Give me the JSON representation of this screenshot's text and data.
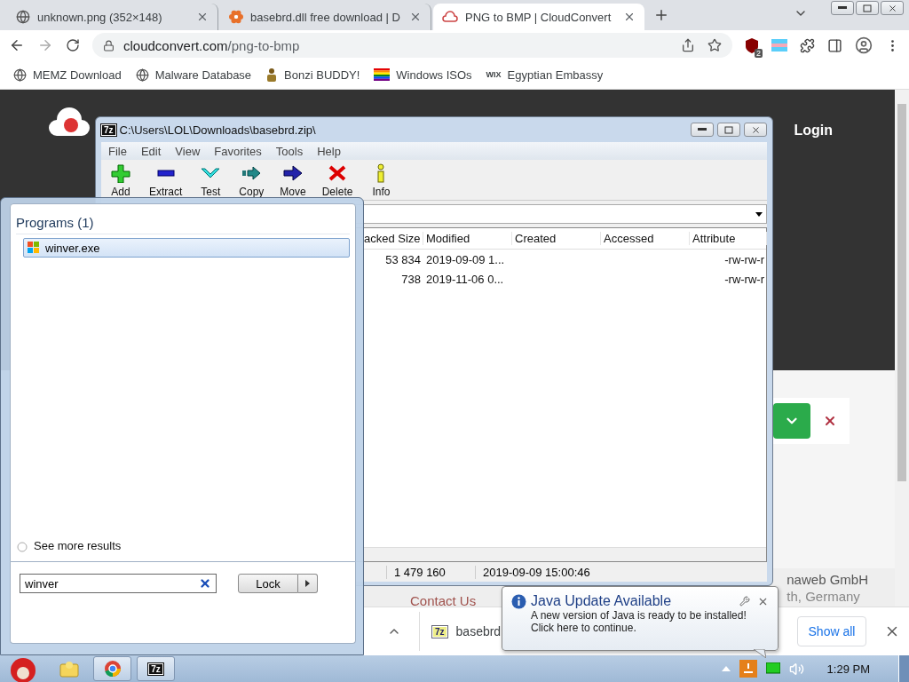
{
  "browser": {
    "tabs": [
      {
        "title": "unknown.png (352×148)",
        "kind": "globe",
        "selected": false
      },
      {
        "title": "basebrd.dll free download | D",
        "kind": "flower",
        "selected": false
      },
      {
        "title": "PNG to BMP | CloudConvert",
        "kind": "cloud",
        "selected": true
      }
    ],
    "address": {
      "host": "cloudconvert.com",
      "path": "/png-to-bmp"
    },
    "extension_badge": "2",
    "bookmarks": [
      {
        "label": "MEMZ Download",
        "kind": "globe"
      },
      {
        "label": "Malware Database",
        "kind": "globe"
      },
      {
        "label": "Bonzi BUDDY!",
        "kind": "figure"
      },
      {
        "label": "Windows ISOs",
        "kind": "rainbow"
      },
      {
        "label": "Egyptian Embassy",
        "kind": "wix",
        "mark": "WIX"
      }
    ]
  },
  "page": {
    "login": "Login",
    "contact": "Contact Us",
    "company": "naweb GmbH",
    "address_line": "th, Germany"
  },
  "downloads": {
    "file": "basebrd",
    "show_all": "Show all"
  },
  "sevenzip": {
    "icon_label": "7z",
    "title": "C:\\Users\\LOL\\Downloads\\basebrd.zip\\",
    "menu": [
      "File",
      "Edit",
      "View",
      "Favorites",
      "Tools",
      "Help"
    ],
    "toolbar": [
      {
        "label": "Add",
        "kind": "add"
      },
      {
        "label": "Extract",
        "kind": "extract"
      },
      {
        "label": "Test",
        "kind": "test"
      },
      {
        "label": "Copy",
        "kind": "copy"
      },
      {
        "label": "Move",
        "kind": "move"
      },
      {
        "label": "Delete",
        "kind": "delete"
      },
      {
        "label": "Info",
        "kind": "info"
      }
    ],
    "columns": [
      "acked Size",
      "Modified",
      "Created",
      "Accessed",
      "Attribute"
    ],
    "rows": [
      {
        "size": "53 834",
        "modified": "2019-09-09 1...",
        "attributes": "-rw-rw-r"
      },
      {
        "size": "738",
        "modified": "2019-11-06 0...",
        "attributes": "-rw-rw-r"
      }
    ],
    "status": [
      "1 479 160",
      "2019-09-09 15:00:46"
    ]
  },
  "start_menu": {
    "group": "Programs (1)",
    "results": [
      {
        "name": "winver.exe",
        "selected": true
      }
    ],
    "more": "See more results",
    "search": {
      "value": "winver"
    },
    "button": "Lock"
  },
  "java_popup": {
    "title": "Java Update Available",
    "lines": [
      "A new version of Java is ready to be installed!",
      "Click here to continue."
    ]
  },
  "taskbar": {
    "apps": [
      {
        "kind": "folder",
        "active": false
      },
      {
        "kind": "chrome",
        "active": true
      },
      {
        "kind": "7z",
        "label": "7z",
        "active": true
      }
    ],
    "clock": "1:29 PM"
  }
}
